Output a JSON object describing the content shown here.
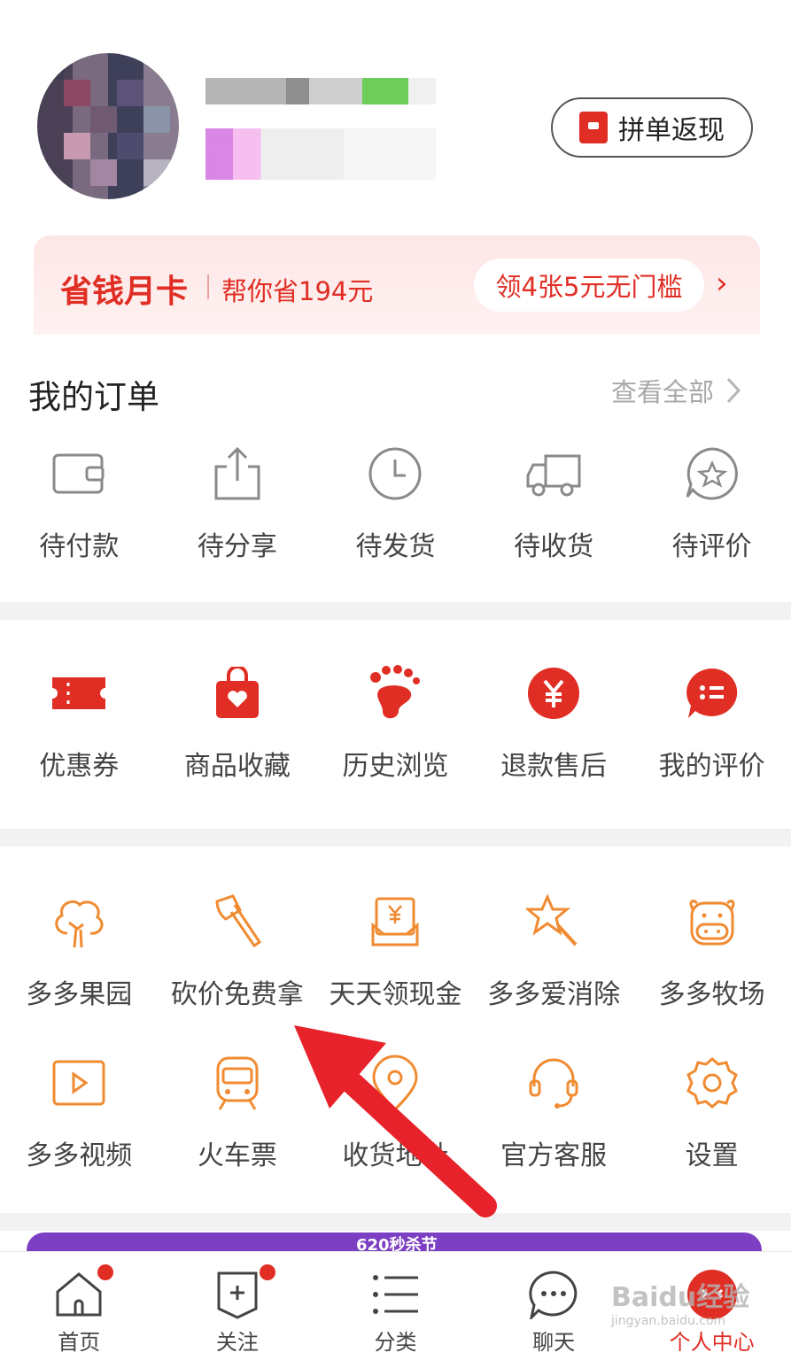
{
  "header": {
    "cashback_button": "拼单返现"
  },
  "savings_card": {
    "title": "省钱月卡",
    "desc": "帮你省194元",
    "coupon": "领4张5元无门槛",
    "chevron": "›"
  },
  "orders": {
    "title": "我的订单",
    "view_all": "查看全部",
    "items": [
      {
        "label": "待付款",
        "icon": "wallet-icon"
      },
      {
        "label": "待分享",
        "icon": "share-icon"
      },
      {
        "label": "待发货",
        "icon": "clock-icon"
      },
      {
        "label": "待收货",
        "icon": "truck-icon"
      },
      {
        "label": "待评价",
        "icon": "star-bubble-icon"
      }
    ]
  },
  "services": {
    "items": [
      {
        "label": "优惠券",
        "icon": "coupon-icon"
      },
      {
        "label": "商品收藏",
        "icon": "heart-bag-icon"
      },
      {
        "label": "历史浏览",
        "icon": "footprint-icon"
      },
      {
        "label": "退款售后",
        "icon": "yuan-icon"
      },
      {
        "label": "我的评价",
        "icon": "comment-icon"
      }
    ]
  },
  "tools": {
    "row1": [
      {
        "label": "多多果园",
        "icon": "tree-icon"
      },
      {
        "label": "砍价免费拿",
        "icon": "axe-icon"
      },
      {
        "label": "天天领现金",
        "icon": "cash-envelope-icon"
      },
      {
        "label": "多多爱消除",
        "icon": "star-wand-icon"
      },
      {
        "label": "多多牧场",
        "icon": "cow-icon"
      }
    ],
    "row2": [
      {
        "label": "多多视频",
        "icon": "video-icon"
      },
      {
        "label": "火车票",
        "icon": "train-icon"
      },
      {
        "label": "收货地址",
        "icon": "location-icon"
      },
      {
        "label": "官方客服",
        "icon": "headset-icon"
      },
      {
        "label": "设置",
        "icon": "gear-icon"
      }
    ]
  },
  "promo_banner": {
    "text": "620秒杀节"
  },
  "tabbar": {
    "tabs": [
      {
        "label": "首页",
        "icon": "home-icon",
        "badge": true
      },
      {
        "label": "关注",
        "icon": "follow-icon",
        "badge": true
      },
      {
        "label": "分类",
        "icon": "list-icon",
        "badge": false
      },
      {
        "label": "聊天",
        "icon": "chat-icon",
        "badge": false
      },
      {
        "label": "个人中心",
        "icon": "profile-icon",
        "badge": false,
        "active": true
      }
    ]
  },
  "watermark": {
    "brand": "Baidu经验",
    "url": "jingyan.baidu.com"
  },
  "colors": {
    "brand_red": "#e02e24",
    "tool_orange": "#f08b32"
  }
}
